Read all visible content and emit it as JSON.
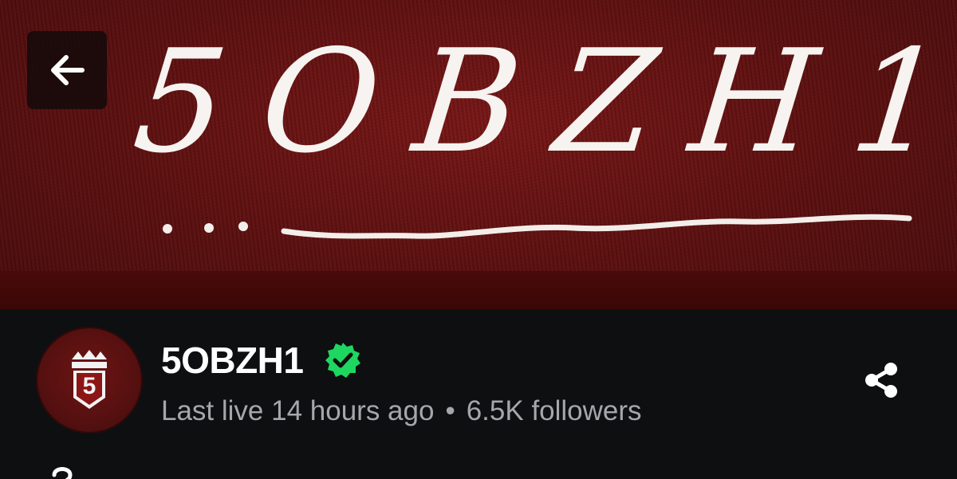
{
  "banner": {
    "text": "5OBZH1",
    "background_color": "#5e1010"
  },
  "header": {
    "back_icon": "arrow-left-icon"
  },
  "channel": {
    "name": "5OBZH1",
    "verified": true,
    "verified_color": "#1ed760",
    "last_live": "Last live 14 hours ago",
    "separator": "•",
    "followers": "6.5K followers",
    "avatar_letter": "5",
    "share_icon": "share-icon"
  },
  "partial_row": {
    "icon": "question-icon"
  }
}
